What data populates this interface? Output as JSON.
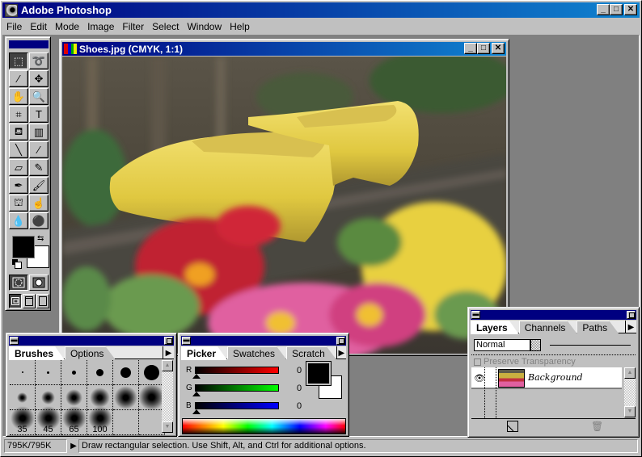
{
  "app": {
    "title": "Adobe Photoshop",
    "window_buttons": {
      "minimize": "_",
      "maximize": "□",
      "close": "✕"
    }
  },
  "menu": [
    "File",
    "Edit",
    "Mode",
    "Image",
    "Filter",
    "Select",
    "Window",
    "Help"
  ],
  "toolbox": {
    "tools": [
      {
        "name": "rectangular-marquee",
        "glyph": "⬚",
        "active": true
      },
      {
        "name": "lasso",
        "glyph": "➰"
      },
      {
        "name": "magic-wand",
        "glyph": "⁄"
      },
      {
        "name": "move",
        "glyph": "✥"
      },
      {
        "name": "hand",
        "glyph": "✋"
      },
      {
        "name": "zoom",
        "glyph": "🔍"
      },
      {
        "name": "crop",
        "glyph": "⌗"
      },
      {
        "name": "type",
        "glyph": "T"
      },
      {
        "name": "paint-bucket",
        "glyph": "⛾"
      },
      {
        "name": "gradient",
        "glyph": "▥"
      },
      {
        "name": "line",
        "glyph": "╲"
      },
      {
        "name": "eyedropper",
        "glyph": "⁄"
      },
      {
        "name": "eraser",
        "glyph": "▱"
      },
      {
        "name": "pencil",
        "glyph": "✎"
      },
      {
        "name": "airbrush",
        "glyph": "✒"
      },
      {
        "name": "paintbrush",
        "glyph": "🖌"
      },
      {
        "name": "rubber-stamp",
        "glyph": "⛫"
      },
      {
        "name": "smudge",
        "glyph": "☝"
      },
      {
        "name": "blur",
        "glyph": "💧"
      },
      {
        "name": "burn",
        "glyph": "⚫"
      }
    ],
    "foreground_color": "#000000",
    "background_color": "#ffffff"
  },
  "document": {
    "title": "Shoes.jpg  (CMYK, 1:1)"
  },
  "brushes": {
    "tabs": [
      "Brushes",
      "Options"
    ],
    "active_tab": "Brushes",
    "rows": [
      [
        {
          "type": "hard",
          "size": 1
        },
        {
          "type": "hard",
          "size": 3
        },
        {
          "type": "hard",
          "size": 5
        },
        {
          "type": "hard",
          "size": 9
        },
        {
          "type": "hard",
          "size": 13
        },
        {
          "type": "hard",
          "size": 19
        }
      ],
      [
        {
          "type": "soft",
          "size": 5
        },
        {
          "type": "soft",
          "size": 9
        },
        {
          "type": "soft",
          "size": 13
        },
        {
          "type": "soft",
          "size": 17
        },
        {
          "type": "soft",
          "size": 21
        },
        {
          "type": "soft",
          "size": 27
        }
      ],
      [
        {
          "type": "soft",
          "size": 35,
          "label": "35"
        },
        {
          "type": "soft",
          "size": 45,
          "label": "45"
        },
        {
          "type": "soft",
          "size": 65,
          "label": "65"
        },
        {
          "type": "soft",
          "size": 100,
          "label": "100"
        }
      ]
    ]
  },
  "picker": {
    "tabs": [
      "Picker",
      "Swatches",
      "Scratch"
    ],
    "active_tab": "Picker",
    "channels": [
      {
        "label": "R",
        "value": "0",
        "color": "#ff0000"
      },
      {
        "label": "G",
        "value": "0",
        "color": "#00ff00"
      },
      {
        "label": "B",
        "value": "0",
        "color": "#0000ff"
      }
    ]
  },
  "layers": {
    "tabs": [
      "Layers",
      "Channels",
      "Paths"
    ],
    "active_tab": "Layers",
    "blend_mode": "Normal",
    "preserve_transparency": "Preserve Transparency",
    "items": [
      {
        "name": "Background",
        "visible": true
      }
    ]
  },
  "status": {
    "doc_size": "795K/795K",
    "message": "Draw rectangular selection.  Use Shift, Alt, and Ctrl for additional options."
  }
}
